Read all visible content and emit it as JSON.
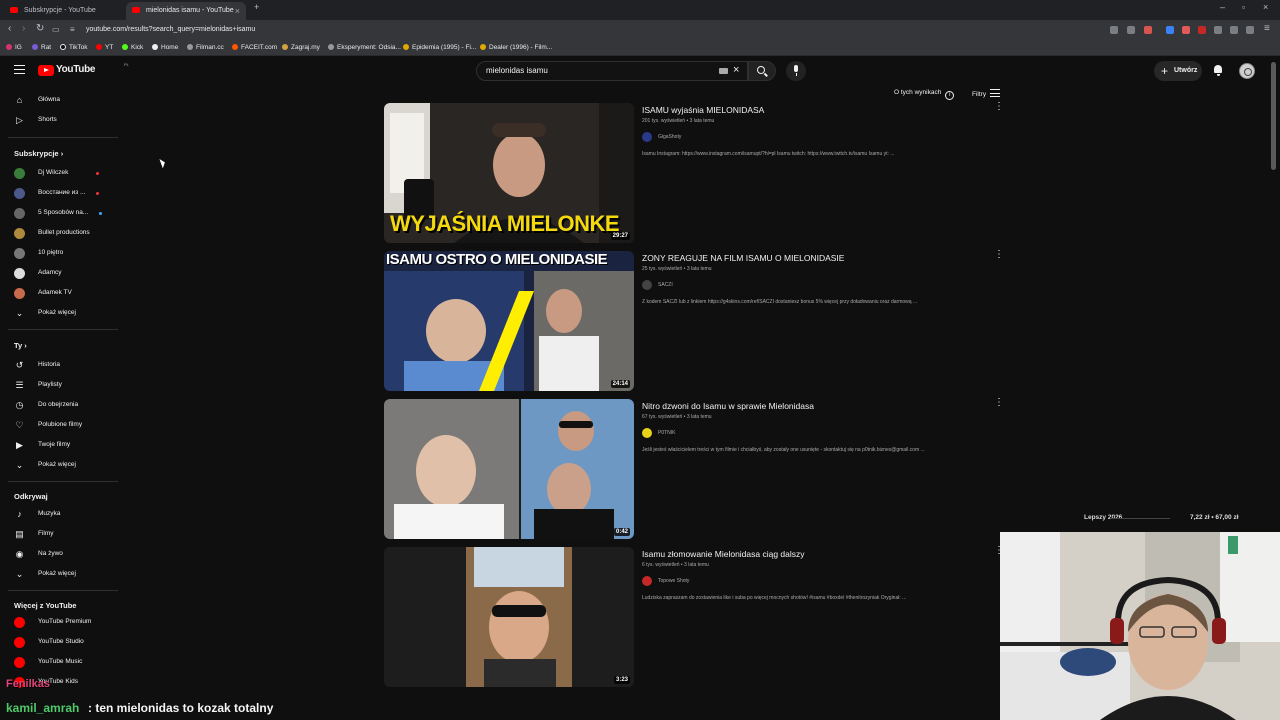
{
  "browser": {
    "tabs": [
      {
        "title": "Subskrypcje - YouTube",
        "active": false
      },
      {
        "title": "mielonidas isamu - YouTube",
        "active": true
      }
    ],
    "url": "youtube.com/results?search_query=mielonidas+isamu",
    "bookmarks": [
      "IG",
      "Rat",
      "TikTok",
      "YT",
      "Kick",
      "Home",
      "Filman.cc",
      "FACEIT.com",
      "Zagraj.my",
      "Eksperyment: Odsia...",
      "Epidemia (1995) - Fi...",
      "Dealer (1996) - Film..."
    ]
  },
  "header": {
    "logo_text": "YouTube",
    "country_code": "PL",
    "search_value": "mielonidas isamu",
    "create_label": "Utwórz"
  },
  "sidebar": {
    "main": [
      {
        "label": "Główna",
        "icon": "home-icon"
      },
      {
        "label": "Shorts",
        "icon": "shorts-icon"
      }
    ],
    "subs_heading": "Subskrypcje",
    "subscriptions": [
      {
        "label": "Dj Wilczek",
        "color": "#3a7d3a",
        "badge": "live"
      },
      {
        "label": "Восстание из ...",
        "color": "#4b5a8a",
        "badge": "live"
      },
      {
        "label": "5 Sposobów na...",
        "color": "#666666",
        "badge": "new"
      },
      {
        "label": "Bullet productions",
        "color": "#b08a3c",
        "badge": ""
      },
      {
        "label": "10 piętro",
        "color": "#777777",
        "badge": ""
      },
      {
        "label": "Adamcy",
        "color": "#dddddd",
        "badge": ""
      },
      {
        "label": "Adamek TV",
        "color": "#c86b4a",
        "badge": ""
      }
    ],
    "show_more": "Pokaż więcej",
    "you_heading": "Ty",
    "you_items": [
      {
        "label": "Historia",
        "icon": "history-icon"
      },
      {
        "label": "Playlisty",
        "icon": "playlist-icon"
      },
      {
        "label": "Do obejrzenia",
        "icon": "watch-later-icon"
      },
      {
        "label": "Polubione filmy",
        "icon": "like-icon"
      },
      {
        "label": "Twoje filmy",
        "icon": "your-videos-icon"
      },
      {
        "label": "Pokaż więcej",
        "icon": "chevron-down-icon"
      }
    ],
    "explore_heading": "Odkrywaj",
    "explore_items": [
      {
        "label": "Muzyka",
        "icon": "music-icon"
      },
      {
        "label": "Filmy",
        "icon": "movies-icon"
      },
      {
        "label": "Na żywo",
        "icon": "live-icon"
      },
      {
        "label": "Pokaż więcej",
        "icon": "chevron-down-icon"
      }
    ],
    "more_heading": "Więcej z YouTube",
    "more_items": [
      {
        "label": "YouTube Premium"
      },
      {
        "label": "YouTube Studio"
      },
      {
        "label": "YouTube Music"
      },
      {
        "label": "YouTube Kids"
      }
    ]
  },
  "results_header": {
    "about_label": "O tych wynikach",
    "filters_label": "Filtry"
  },
  "results": [
    {
      "title": "ISAMU wyjaśnia MIELONIDASA",
      "meta": "201 tys. wyświetleń • 3 lata temu",
      "channel": "GigaShoty",
      "channel_color": "#2a3a8a",
      "description": "Isamu Instagram: https://www.instagram.com/isamupt/?hl=pl Isamu twitch: https://www.twitch.tv/isamu Isamu yt: ...",
      "duration": "29:27",
      "thumb_caption": "WYJAŚNIA MIELONKE"
    },
    {
      "title": "ZONY REAGUJE NA FILM ISAMU O MIELONIDASIE",
      "meta": "25 tys. wyświetleń • 3 lata temu",
      "channel": "SACZI",
      "channel_color": "#444444",
      "description": "Z kodem SACZI lub z linkiem https://g4skins.com/ref/SACZI dostaniesz bonus 5% więcej przy doładowaniu oraz darmową ...",
      "duration": "24:14",
      "thumb_caption": "ISAMU OSTRO O MIELONIDASIE"
    },
    {
      "title": "Nitro dzwoni do Isamu w sprawie Mielonidasa",
      "meta": "67 tys. wyświetleń • 3 lata temu",
      "channel": "P0TNIK",
      "channel_color": "#e8d21a",
      "description": "Jeśli jesteś właścicielem treści w tym filmie i chciałbyś, aby zostały one usunięte - skontaktuj się na p0tnik.biznes@gmail.com ...",
      "duration": "0:42",
      "thumb_caption": ""
    },
    {
      "title": "Isamu złomowanie Mielonidasa ciąg dalszy",
      "meta": "6 tys. wyświetleń • 3 lata temu",
      "channel": "Topowe Shoty",
      "channel_color": "#c62828",
      "description": "Ludziska zapraszam do zostawienia like i suba po więcej mocnych shotów! #isamu #boxdel #thenitrozyniak Oryginał: ...",
      "duration": "3:23",
      "thumb_caption": ""
    }
  ],
  "overlay": {
    "ticker_name": "Lepszy 2026",
    "ticker_price": "7,22 zł • 67,00 zł",
    "chat_user": "kamil_amrah",
    "chat_message": ": ten mielonidas to kozak totalny",
    "follow_alert": "Fenilkas"
  }
}
